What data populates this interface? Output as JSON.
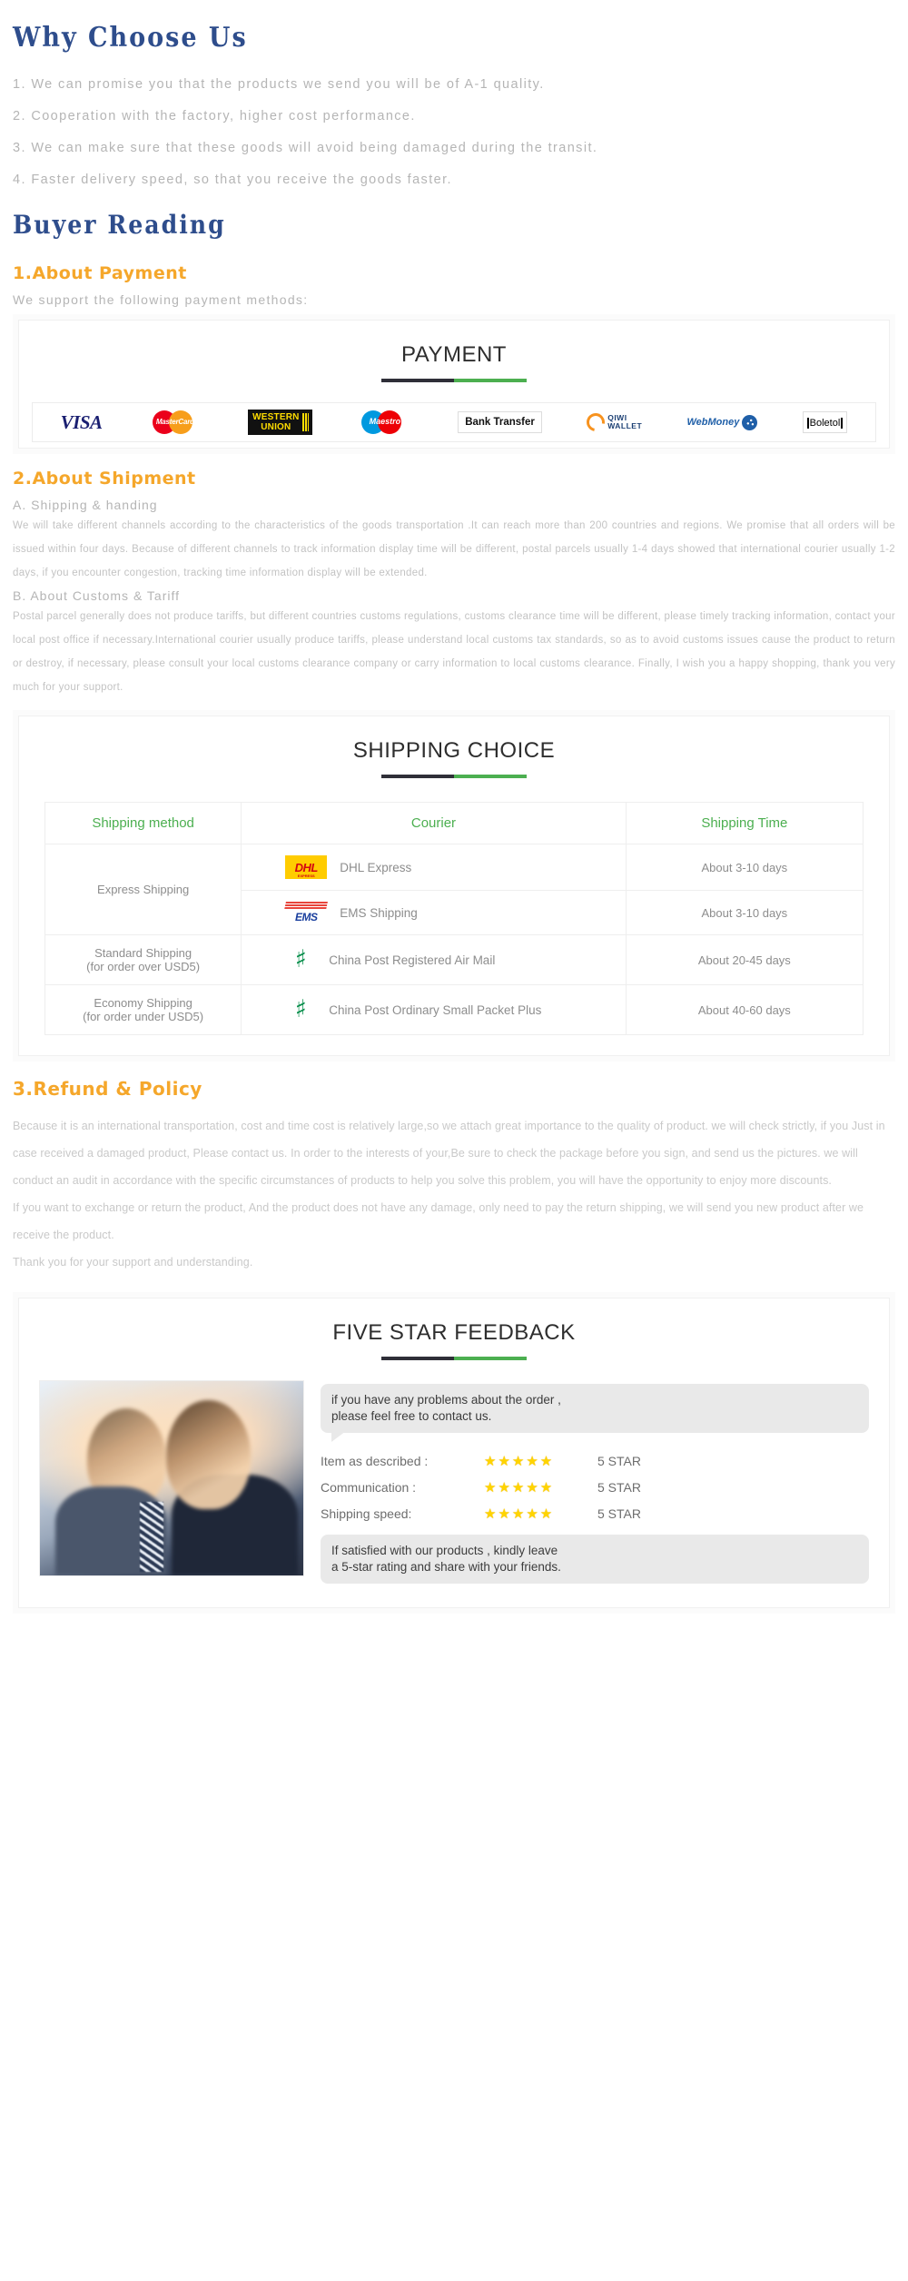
{
  "why_choose_us": {
    "title": "Why Choose Us",
    "items": [
      "1. We can promise you that the products we send you will be of A-1 quality.",
      "2. Cooperation with the factory, higher cost performance.",
      "3. We can make sure that these goods will avoid being damaged during the transit.",
      "4. Faster delivery speed, so that you receive the goods faster."
    ]
  },
  "buyer_reading": {
    "title": "Buyer Reading"
  },
  "payment": {
    "section_title": "1.About Payment",
    "subtitle": "We support the following payment methods:",
    "card_title": "PAYMENT",
    "methods": [
      {
        "name": "visa-logo",
        "label": "VISA"
      },
      {
        "name": "mastercard-logo",
        "label": "MasterCard"
      },
      {
        "name": "western-union-logo",
        "label_line1": "WESTERN",
        "label_line2": "UNION"
      },
      {
        "name": "maestro-logo",
        "label": "Maestro"
      },
      {
        "name": "bank-transfer-logo",
        "label": "Bank Transfer"
      },
      {
        "name": "qiwi-wallet-logo",
        "label_line1": "QIWI",
        "label_line2": "WALLET"
      },
      {
        "name": "webmoney-logo",
        "label": "WebMoney"
      },
      {
        "name": "boleto-logo",
        "label": "Boletol"
      }
    ]
  },
  "shipment": {
    "section_title": "2.About Shipment",
    "part_a_title": "A. Shipping & handing",
    "part_a_body": "We will take different channels according to the characteristics of the goods transportation .It can reach more than 200 countries and regions. We promise that all orders will be issued within four days. Because of different channels to track information display time will be different, postal parcels usually 1-4 days showed that international courier usually 1-2 days, if you encounter congestion, tracking time information display will be extended.",
    "part_b_title": "B. About Customs & Tariff",
    "part_b_body": "Postal parcel generally does not produce tariffs, but different countries customs regulations, customs clearance time will be different, please timely tracking information, contact your local post office if necessary.International courier usually produce tariffs, please understand local customs tax standards, so as to avoid customs issues cause the product to return or destroy, if necessary, please consult your local customs clearance company or carry information to local customs clearance. Finally, I wish you a happy shopping, thank you very much for your support."
  },
  "shipping_choice": {
    "card_title": "SHIPPING CHOICE",
    "columns": [
      "Shipping method",
      "Courier",
      "Shipping Time"
    ],
    "rows": [
      {
        "method": "Express Shipping",
        "rowspan": 2,
        "couriers": [
          {
            "logo": "dhl-logo",
            "logo_text": "DHL",
            "logo_sub": "EXPRESS",
            "name": "DHL Express",
            "time": "About 3-10 days"
          },
          {
            "logo": "ems-logo",
            "logo_text": "EMS",
            "name": "EMS Shipping",
            "time": "About 3-10 days"
          }
        ]
      },
      {
        "method": "Standard Shipping\n(for order over USD5)",
        "method_line1": "Standard Shipping",
        "method_line2": "(for order over USD5)",
        "rowspan": 1,
        "couriers": [
          {
            "logo": "china-post-logo",
            "name": "China Post Registered Air Mail",
            "time": "About 20-45 days"
          }
        ]
      },
      {
        "method_line1": "Economy Shipping",
        "method_line2": "(for order under USD5)",
        "rowspan": 1,
        "couriers": [
          {
            "logo": "china-post-logo",
            "name": "China Post Ordinary Small Packet Plus",
            "time": "About 40-60 days"
          }
        ]
      }
    ]
  },
  "refund": {
    "section_title": "3.Refund & Policy",
    "paragraphs": [
      "Because it is an international transportation, cost and time cost is relatively large,so we attach great importance to the quality of product. we will check strictly, if you Just in case received a damaged product, Please contact us. In order to the interests of your,Be sure to check the package before you sign, and send us the pictures. we will conduct an audit in accordance with the specific circumstances of products to help you solve this problem, you will have the opportunity to enjoy more discounts.",
      "If you want to exchange or return the product, And the product does not have any damage, only need to pay the return shipping, we will send you new product after we receive the product.",
      "Thank you for your support and understanding."
    ]
  },
  "feedback": {
    "card_title": "FIVE STAR FEEDBACK",
    "bubble_top_line1": "if you have any problems about the order ,",
    "bubble_top_line2": "please feel free to contact us.",
    "ratings": [
      {
        "label": "Item as described :",
        "stars": "★★★★★",
        "value": "5 STAR"
      },
      {
        "label": "Communication :",
        "stars": "★★★★★",
        "value": "5 STAR"
      },
      {
        "label": "Shipping speed:",
        "stars": "★★★★★",
        "value": "5 STAR"
      }
    ],
    "bubble_bottom_line1": "If satisfied with our products ,  kindly leave",
    "bubble_bottom_line2": "a 5-star rating and share with your friends."
  },
  "colors": {
    "heading_blue": "#2e4d8c",
    "heading_orange": "#f5a72b",
    "accent_green": "#4caf50",
    "accent_dark": "#2f2f38",
    "body_grey": "#c3c3c3",
    "star_yellow": "#ffd400"
  }
}
